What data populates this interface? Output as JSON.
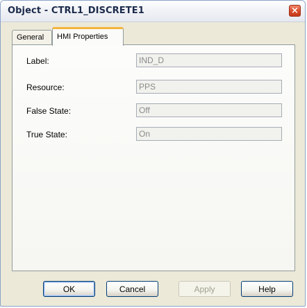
{
  "window": {
    "title": "Object - CTRL1_DISCRETE1",
    "close_glyph": "×"
  },
  "tabs": [
    {
      "label": "General",
      "active": false
    },
    {
      "label": "HMI Properties",
      "active": true
    }
  ],
  "fields": [
    {
      "label": "Label:",
      "value": "IND_D"
    },
    {
      "label": "Resource:",
      "value": "PPS"
    },
    {
      "label": "False State:",
      "value": "Off"
    },
    {
      "label": "True State:",
      "value": "On"
    }
  ],
  "buttons": {
    "ok": "OK",
    "cancel": "Cancel",
    "apply": "Apply",
    "help": "Help"
  },
  "icons": {
    "close": "close-icon"
  },
  "colors": {
    "active_tab_accent": "#f5b43c",
    "close_button": "#d94b28"
  }
}
